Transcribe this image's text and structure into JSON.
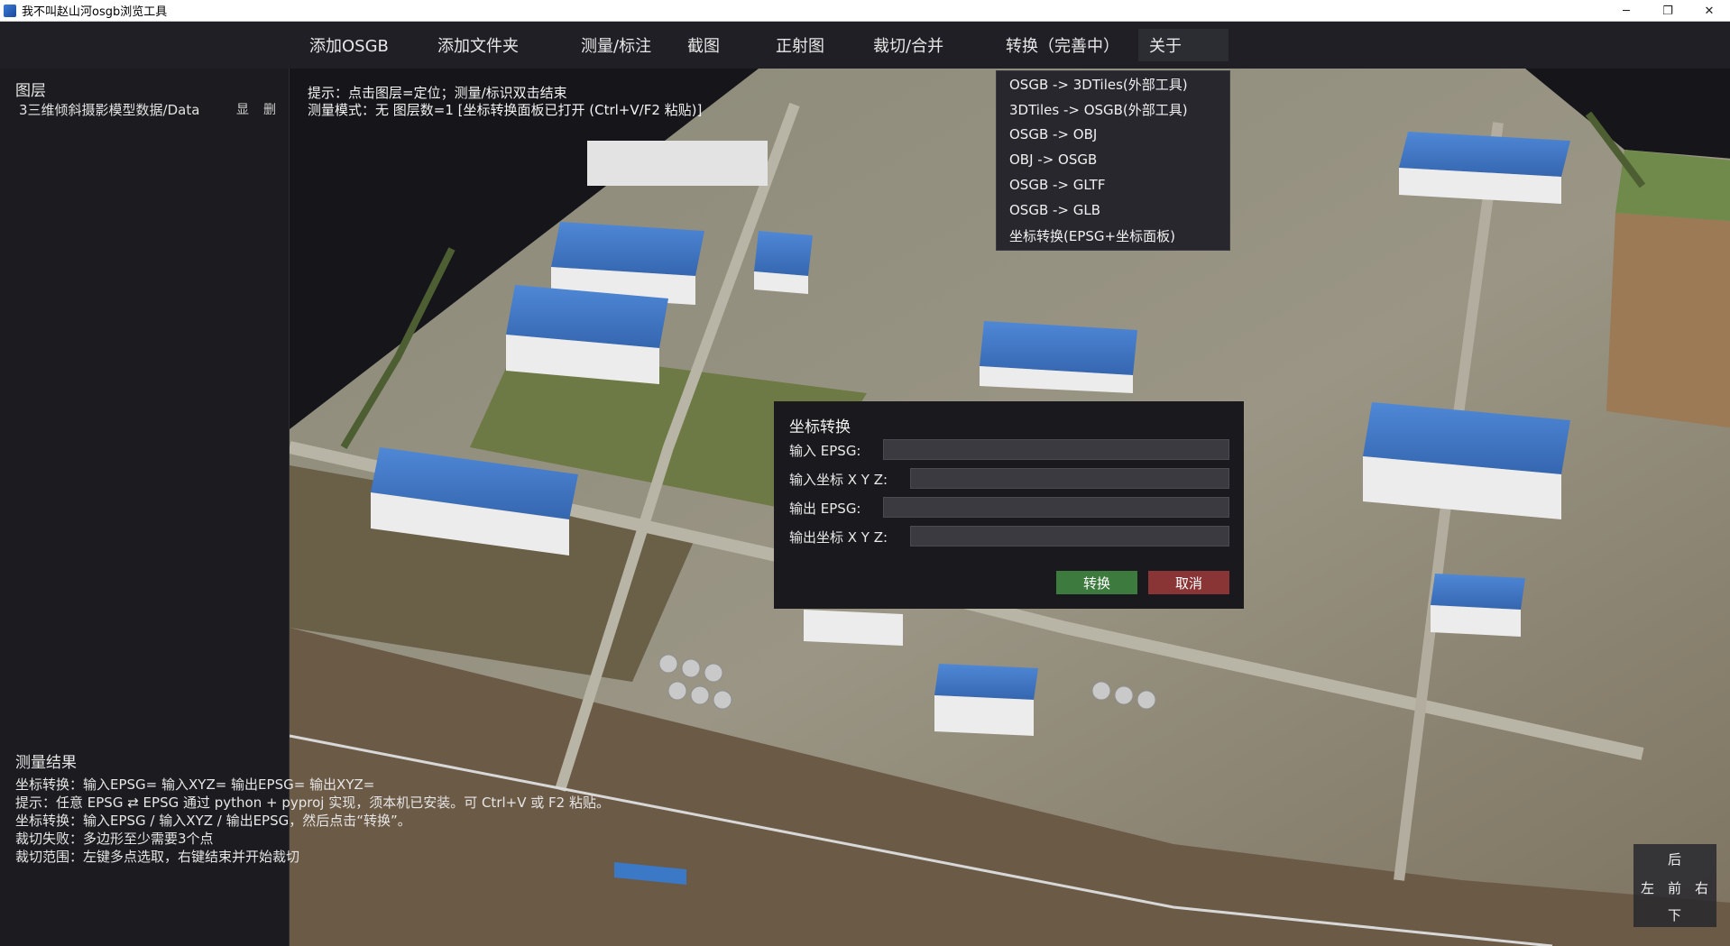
{
  "window": {
    "title": "我不叫赵山河osgb浏览工具",
    "controls": [
      "─",
      "❐",
      "✕"
    ]
  },
  "menu": {
    "items": [
      "添加OSGB",
      "添加文件夹",
      "测量/标注",
      "截图",
      "正射图",
      "裁切/合并",
      "转换（完善中）",
      "关于"
    ],
    "active_item": "关于"
  },
  "sidebar": {
    "layers_heading": "图层",
    "layers": [
      {
        "name": "3三维倾斜摄影模型数据/Data",
        "show_label": "显",
        "delete_label": "删"
      }
    ],
    "results_heading": "测量结果",
    "results_lines": [
      "坐标转换：输入EPSG=  输入XYZ=  输出EPSG=  输出XYZ=",
      "提示：任意 EPSG ⇄ EPSG 通过 python + pyproj 实现，须本机已安装。可 Ctrl+V 或 F2 粘贴。",
      "坐标转换：输入EPSG / 输入XYZ / 输出EPSG，然后点击“转换”。",
      "裁切失败：多边形至少需要3个点",
      "裁切范围：左键多点选取，右键结束并开始裁切"
    ]
  },
  "hint": {
    "line1": "提示：点击图层=定位；测量/标识双击结束",
    "line2": "测量模式：无   图层数=1   [坐标转换面板已打开 (Ctrl+V/F2 粘贴)]"
  },
  "convert_menu": {
    "options": [
      "OSGB -> 3DTiles(外部工具)",
      "3DTiles -> OSGB(外部工具)",
      "OSGB -> OBJ",
      "OBJ -> OSGB",
      "OSGB -> GLTF",
      "OSGB -> GLB",
      "坐标转换(EPSG+坐标面板)"
    ]
  },
  "dialog": {
    "title": "坐标转换",
    "input_epsg_label": "输入 EPSG:",
    "input_xyz_label": "输入坐标 X Y Z:",
    "output_epsg_label": "输出 EPSG:",
    "output_xyz_label": "输出坐标 X Y Z:",
    "input_epsg_value": "",
    "input_xyz_value": "",
    "output_epsg_value": "",
    "output_xyz_value": "",
    "convert_label": "转换",
    "cancel_label": "取消"
  },
  "navpad": {
    "back": "后",
    "left": "左",
    "center": "前",
    "right": "右",
    "down": "下"
  },
  "colors": {
    "background": "#1c1c22",
    "convert_button": "#3d7a3d",
    "cancel_button": "#8a3535",
    "roof_blue": "#3f78c9"
  }
}
